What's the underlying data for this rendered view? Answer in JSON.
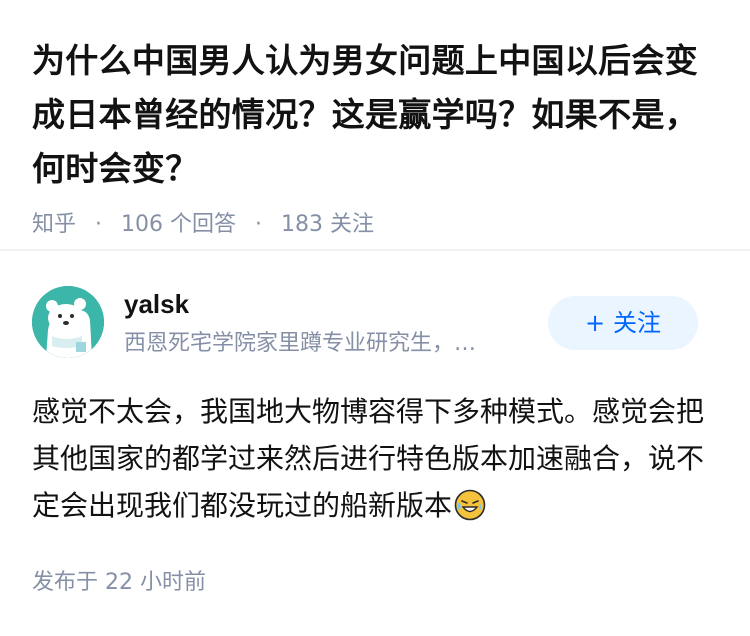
{
  "question": {
    "title": "为什么中国男人认为男女问题上中国以后会变成日本曾经的情况？这是赢学吗？如果不是，何时会变？",
    "source": "知乎",
    "separator": "·",
    "answer_count": "106 个回答",
    "follower_count": "183 关注"
  },
  "answer": {
    "author": {
      "name": "yalsk",
      "bio": "西恩死宅学院家里蹲专业研究生，…",
      "avatar_icon": "polar-bear-avatar"
    },
    "follow_button": {
      "plus": "+",
      "label": "关注"
    },
    "content": "感觉不太会，我国地大物博容得下多种模式。感觉会把其他国家的都学过来然后进行特色版本加速融合，说不定会出现我们都没玩过的船新版本",
    "content_emoji": "laughing-tears-emoji",
    "published": "发布于 22 小时前"
  },
  "colors": {
    "title_text": "#121212",
    "meta_text": "#8590a6",
    "brand_blue": "#0066ff",
    "follow_button_bg": "#ebf5ff",
    "avatar_bg": "#3cb6a8"
  }
}
